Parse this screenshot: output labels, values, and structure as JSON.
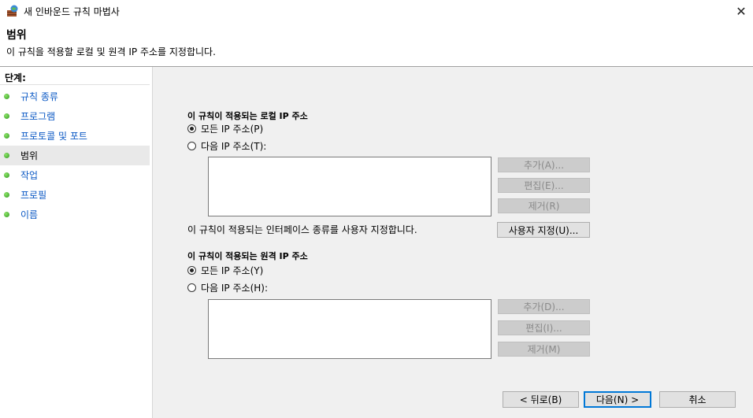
{
  "window": {
    "title": "새 인바운드 규칙 마법사",
    "close_glyph": "✕"
  },
  "header": {
    "title": "범위",
    "description": "이 규칙을 적용할 로컬 및 원격 IP 주소를 지정합니다."
  },
  "steps": {
    "heading": "단계:",
    "items": [
      {
        "label": "규칙 종류",
        "active": false
      },
      {
        "label": "프로그램",
        "active": false
      },
      {
        "label": "프로토콜 및 포트",
        "active": false
      },
      {
        "label": "범위",
        "active": true
      },
      {
        "label": "작업",
        "active": false
      },
      {
        "label": "프로필",
        "active": false
      },
      {
        "label": "이름",
        "active": false
      }
    ]
  },
  "local": {
    "title": "이 규칙이 적용되는 로컬 IP 주소",
    "opt_any": "모든 IP 주소(P)",
    "opt_these": "다음 IP 주소(T):",
    "selected": "any",
    "add": "추가(A)...",
    "edit": "편집(E)...",
    "remove": "제거(R)"
  },
  "interface": {
    "text": "이 규칙이 적용되는 인터페이스 종류를 사용자 지정합니다.",
    "customize": "사용자 지정(U)..."
  },
  "remote": {
    "title": "이 규칙이 적용되는 원격 IP 주소",
    "opt_any": "모든 IP 주소(Y)",
    "opt_these": "다음 IP 주소(H):",
    "selected": "any",
    "add": "추가(D)...",
    "edit": "편집(I)...",
    "remove": "제거(M)"
  },
  "footer": {
    "back": "< 뒤로(B)",
    "next": "다음(N) >",
    "cancel": "취소"
  }
}
